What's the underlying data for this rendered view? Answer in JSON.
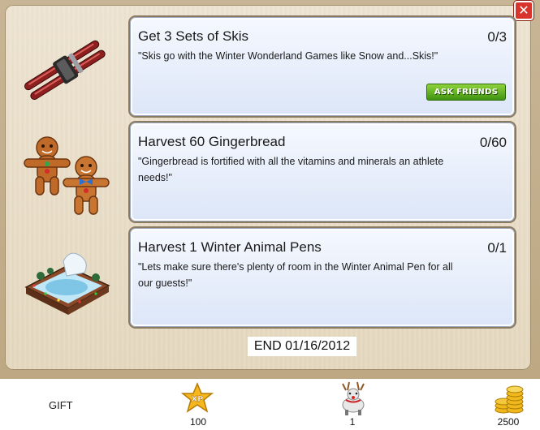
{
  "close": {
    "label": "✕"
  },
  "quests": [
    {
      "title": "Get 3 Sets of Skis",
      "description": "\"Skis go with the Winter Wonderland Games like Snow and...Skis!\"",
      "progress": "0/3",
      "icon": "skis-icon",
      "action_label": "ASK FRIENDS"
    },
    {
      "title": "Harvest 60 Gingerbread",
      "description": "\"Gingerbread is fortified with all the vitamins and minerals an athlete needs!\"",
      "progress": "0/60",
      "icon": "gingerbread-icon"
    },
    {
      "title": "Harvest 1 Winter Animal Pens",
      "description": "\"Lets make sure there's plenty of room in the Winter Animal Pen for all our guests!\"",
      "progress": "0/1",
      "icon": "winter-animal-pen-icon"
    }
  ],
  "end_date": "END 01/16/2012",
  "rewards": {
    "gift_label": "GIFT",
    "xp": {
      "icon_text": "XP",
      "value": "100",
      "icon": "xp-star-icon"
    },
    "animal": {
      "value": "1",
      "icon": "reindeer-icon"
    },
    "coins": {
      "value": "2500",
      "icon": "coins-icon"
    }
  },
  "colors": {
    "panel": "#e9dfcb",
    "card": "#e6edfb",
    "button_green": "#5fb21e",
    "close_red": "#d9342b"
  }
}
